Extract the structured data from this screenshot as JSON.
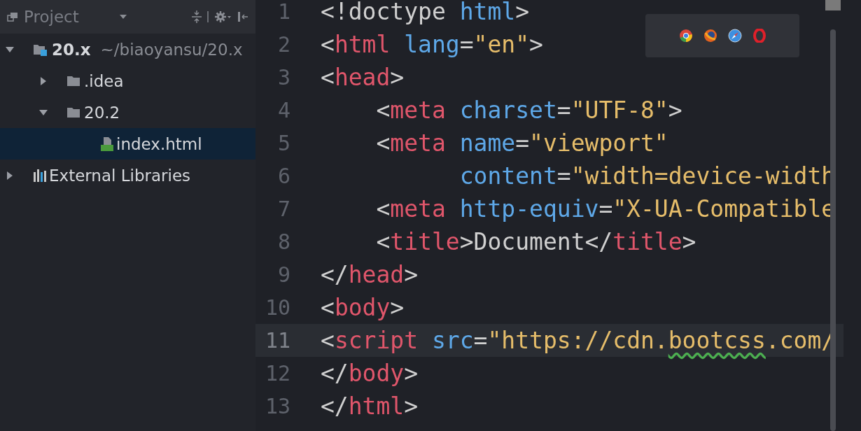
{
  "sidebar": {
    "title": "Project",
    "tree": [
      {
        "label": "20.x",
        "path": "~/biaoyansu/20.x",
        "kind": "module",
        "expanded": true,
        "selected": false,
        "children": [
          {
            "label": ".idea",
            "kind": "folder",
            "expanded": false,
            "selected": false
          },
          {
            "label": "20.2",
            "kind": "folder",
            "expanded": true,
            "selected": false,
            "children": [
              {
                "label": "index.html",
                "kind": "html-file",
                "selected": true
              }
            ]
          }
        ]
      },
      {
        "label": "External Libraries",
        "kind": "library",
        "expanded": false,
        "selected": false
      }
    ]
  },
  "editor": {
    "lines": [
      {
        "number": "1",
        "current": false,
        "tokens": [
          {
            "kind": "punct",
            "text": "<!doctype "
          },
          {
            "kind": "attr",
            "text": "html"
          },
          {
            "kind": "punct",
            "text": ">"
          }
        ]
      },
      {
        "number": "2",
        "current": false,
        "tokens": [
          {
            "kind": "punct",
            "text": "<"
          },
          {
            "kind": "tag",
            "text": "html"
          },
          {
            "kind": "attr",
            "text": " lang"
          },
          {
            "kind": "punct",
            "text": "="
          },
          {
            "kind": "string",
            "text": "\"en\""
          },
          {
            "kind": "punct",
            "text": ">"
          }
        ]
      },
      {
        "number": "3",
        "current": false,
        "tokens": [
          {
            "kind": "punct",
            "text": "<"
          },
          {
            "kind": "tag",
            "text": "head"
          },
          {
            "kind": "punct",
            "text": ">"
          }
        ]
      },
      {
        "number": "4",
        "current": false,
        "tokens": [
          {
            "kind": "punct",
            "text": "    <"
          },
          {
            "kind": "tag",
            "text": "meta"
          },
          {
            "kind": "attr",
            "text": " charset"
          },
          {
            "kind": "punct",
            "text": "="
          },
          {
            "kind": "string",
            "text": "\"UTF-8\""
          },
          {
            "kind": "punct",
            "text": ">"
          }
        ]
      },
      {
        "number": "5",
        "current": false,
        "tokens": [
          {
            "kind": "punct",
            "text": "    <"
          },
          {
            "kind": "tag",
            "text": "meta"
          },
          {
            "kind": "attr",
            "text": " name"
          },
          {
            "kind": "punct",
            "text": "="
          },
          {
            "kind": "string",
            "text": "\"viewport\""
          }
        ]
      },
      {
        "number": "6",
        "current": false,
        "tokens": [
          {
            "kind": "attr",
            "text": "          content"
          },
          {
            "kind": "punct",
            "text": "="
          },
          {
            "kind": "string",
            "text": "\"width=device-width"
          }
        ]
      },
      {
        "number": "7",
        "current": false,
        "tokens": [
          {
            "kind": "punct",
            "text": "    <"
          },
          {
            "kind": "tag",
            "text": "meta"
          },
          {
            "kind": "attr",
            "text": " http-equiv"
          },
          {
            "kind": "punct",
            "text": "="
          },
          {
            "kind": "string",
            "text": "\"X-UA-Compatible"
          }
        ]
      },
      {
        "number": "8",
        "current": false,
        "tokens": [
          {
            "kind": "punct",
            "text": "    <"
          },
          {
            "kind": "tag",
            "text": "title"
          },
          {
            "kind": "punct",
            "text": ">Document</"
          },
          {
            "kind": "tag",
            "text": "title"
          },
          {
            "kind": "punct",
            "text": ">"
          }
        ]
      },
      {
        "number": "9",
        "current": false,
        "tokens": [
          {
            "kind": "punct",
            "text": "</"
          },
          {
            "kind": "tag",
            "text": "head"
          },
          {
            "kind": "punct",
            "text": ">"
          }
        ]
      },
      {
        "number": "10",
        "current": false,
        "tokens": [
          {
            "kind": "punct",
            "text": "<"
          },
          {
            "kind": "tag",
            "text": "body"
          },
          {
            "kind": "punct",
            "text": ">"
          }
        ]
      },
      {
        "number": "11",
        "current": true,
        "tokens": [
          {
            "kind": "punct",
            "text": "<"
          },
          {
            "kind": "tag",
            "text": "script"
          },
          {
            "kind": "attr",
            "text": " src"
          },
          {
            "kind": "punct",
            "text": "="
          },
          {
            "kind": "string",
            "text": "\"https://cdn."
          },
          {
            "kind": "warning",
            "text": "bootcss"
          },
          {
            "kind": "string",
            "text": ".com/"
          }
        ]
      },
      {
        "number": "12",
        "current": false,
        "tokens": [
          {
            "kind": "punct",
            "text": "</"
          },
          {
            "kind": "tag",
            "text": "body"
          },
          {
            "kind": "punct",
            "text": ">"
          }
        ]
      },
      {
        "number": "13",
        "current": false,
        "tokens": [
          {
            "kind": "punct",
            "text": "</"
          },
          {
            "kind": "tag",
            "text": "html"
          },
          {
            "kind": "punct",
            "text": ">"
          }
        ]
      }
    ]
  }
}
